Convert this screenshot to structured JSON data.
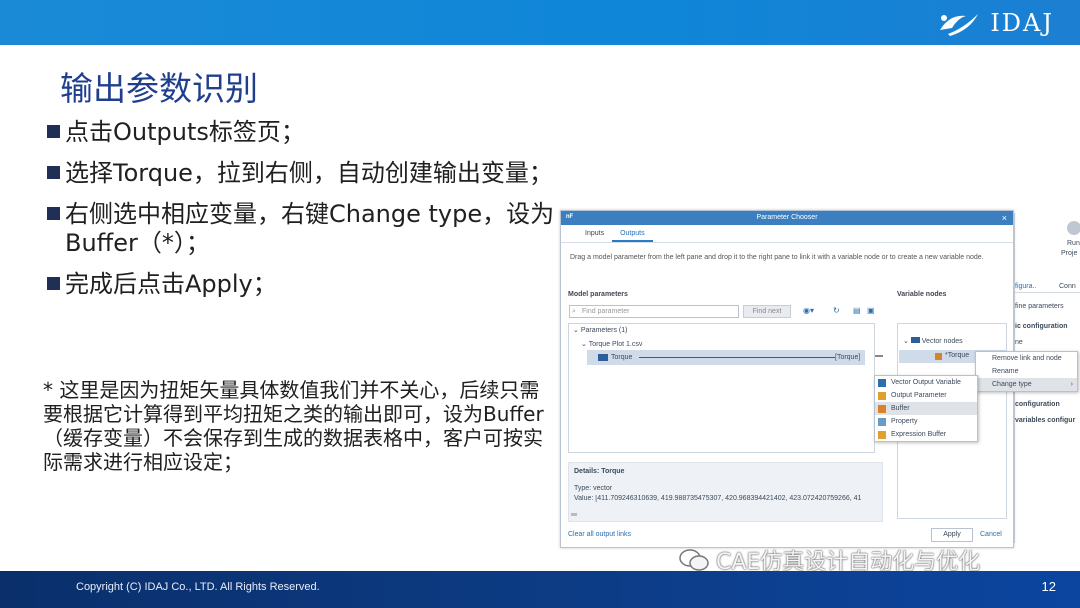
{
  "slide": {
    "title": "输出参数识别",
    "bullets": [
      "点击Outputs标签页；",
      "选择Torque，拉到右侧，自动创建输出变量；",
      "右侧选中相应变量，右键Change type，设为Buffer（*）；",
      "完成后点击Apply；"
    ],
    "note": "* 这里是因为扭矩矢量具体数值我们并不关心，后续只需要根据它计算得到平均扭矩之类的输出即可，设为Buffer（缓存变量）不会保存到生成的数据表格中，客户可按实际需求进行相应设定；",
    "logo_text": "IDAJ",
    "copyright": "Copyright (C) IDAJ Co., LTD. All Rights Reserved.",
    "page_number": "12",
    "watermark": "CAE仿真设计自动化与优化"
  },
  "dialog": {
    "title": "Parameter Chooser",
    "tabs": [
      "Inputs",
      "Outputs"
    ],
    "description": "Drag a model parameter from the left pane and drop it to the right pane to link it with a variable node or to create a new variable node.",
    "model_params_label": "Model parameters",
    "variable_nodes_label": "Variable nodes",
    "search_placeholder": "Find parameter",
    "find_next": "Find next",
    "tree": {
      "root": "Parameters (1)",
      "file": "Torque Plot 1.csv",
      "item": "Torque",
      "linked": "[Torque]"
    },
    "variable_nodes": {
      "root": "Vector nodes",
      "item": "*Torque"
    },
    "details_title": "Details: Torque",
    "details_type": "Type: vector",
    "details_value": "Value: [411.709246310639, 419.988735475307, 420.968394421402, 423.072420759266, 41",
    "clear_links": "Clear all output links",
    "apply": "Apply",
    "cancel": "Cancel"
  },
  "context_menu": {
    "items": [
      "Remove link and node",
      "Rename",
      "Change type"
    ]
  },
  "submenu": {
    "items": [
      "Vector Output Variable",
      "Output Parameter",
      "Buffer",
      "Property",
      "Expression Buffer"
    ],
    "selected": "Buffer"
  },
  "background_window": {
    "run": "Run",
    "proj": "Proje",
    "tab1": "figura..",
    "tab2": "Conn",
    "define_params": "fine parameters",
    "configuration1": "ic configuration",
    "name_label": "ne",
    "configuration2": "configuration",
    "variables_config": "variables configur"
  }
}
